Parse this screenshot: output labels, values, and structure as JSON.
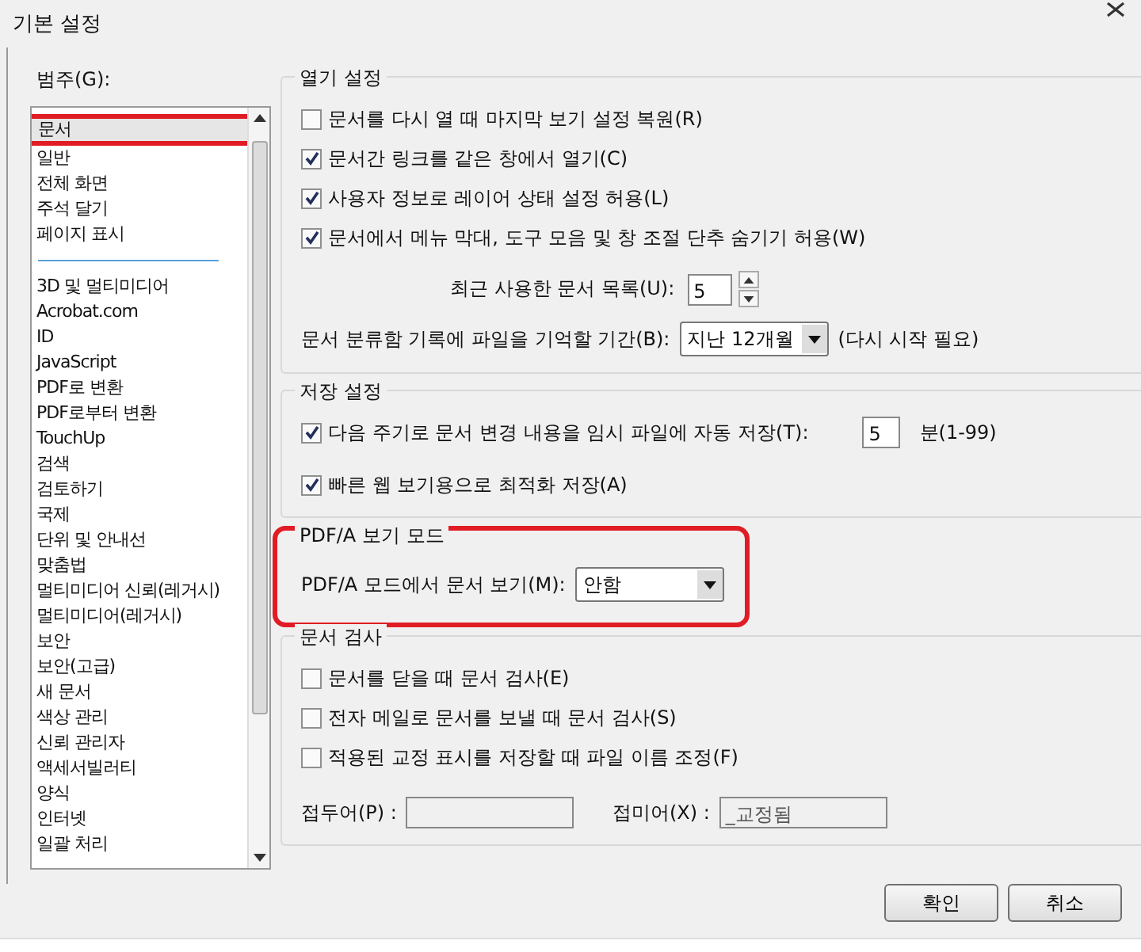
{
  "window": {
    "title": "기본 설정"
  },
  "category_label": "범주(G):",
  "categories": [
    {
      "kind": "item",
      "label": "문서",
      "selected": true,
      "highlighted": true
    },
    {
      "kind": "item",
      "label": "일반",
      "selected": false,
      "highlighted": false
    },
    {
      "kind": "item",
      "label": "전체 화면",
      "selected": false,
      "highlighted": false
    },
    {
      "kind": "item",
      "label": "주석 달기",
      "selected": false,
      "highlighted": false
    },
    {
      "kind": "item",
      "label": "페이지 표시",
      "selected": false,
      "highlighted": false
    },
    {
      "kind": "separator"
    },
    {
      "kind": "item",
      "label": "3D 및 멀티미디어",
      "selected": false,
      "highlighted": false
    },
    {
      "kind": "item",
      "label": "Acrobat.com",
      "selected": false,
      "highlighted": false
    },
    {
      "kind": "item",
      "label": "ID",
      "selected": false,
      "highlighted": false
    },
    {
      "kind": "item",
      "label": "JavaScript",
      "selected": false,
      "highlighted": false
    },
    {
      "kind": "item",
      "label": "PDF로 변환",
      "selected": false,
      "highlighted": false
    },
    {
      "kind": "item",
      "label": "PDF로부터 변환",
      "selected": false,
      "highlighted": false
    },
    {
      "kind": "item",
      "label": "TouchUp",
      "selected": false,
      "highlighted": false
    },
    {
      "kind": "item",
      "label": "검색",
      "selected": false,
      "highlighted": false
    },
    {
      "kind": "item",
      "label": "검토하기",
      "selected": false,
      "highlighted": false
    },
    {
      "kind": "item",
      "label": "국제",
      "selected": false,
      "highlighted": false
    },
    {
      "kind": "item",
      "label": "단위 및 안내선",
      "selected": false,
      "highlighted": false
    },
    {
      "kind": "item",
      "label": "맞춤법",
      "selected": false,
      "highlighted": false
    },
    {
      "kind": "item",
      "label": "멀티미디어 신뢰(레거시)",
      "selected": false,
      "highlighted": false
    },
    {
      "kind": "item",
      "label": "멀티미디어(레거시)",
      "selected": false,
      "highlighted": false
    },
    {
      "kind": "item",
      "label": "보안",
      "selected": false,
      "highlighted": false
    },
    {
      "kind": "item",
      "label": "보안(고급)",
      "selected": false,
      "highlighted": false
    },
    {
      "kind": "item",
      "label": "새 문서",
      "selected": false,
      "highlighted": false
    },
    {
      "kind": "item",
      "label": "색상 관리",
      "selected": false,
      "highlighted": false
    },
    {
      "kind": "item",
      "label": "신뢰 관리자",
      "selected": false,
      "highlighted": false
    },
    {
      "kind": "item",
      "label": "액세서빌러티",
      "selected": false,
      "highlighted": false
    },
    {
      "kind": "item",
      "label": "양식",
      "selected": false,
      "highlighted": false
    },
    {
      "kind": "item",
      "label": "인터넷",
      "selected": false,
      "highlighted": false
    },
    {
      "kind": "item",
      "label": "일괄 처리",
      "selected": false,
      "highlighted": false
    }
  ],
  "sections": [
    {
      "title": "열기 설정",
      "highlighted": false,
      "rows": [
        {
          "kind": "checkbox",
          "label": "문서를 다시 열 때 마지막 보기 설정 복원(R)",
          "checked": false
        },
        {
          "kind": "checkbox",
          "label": "문서간 링크를 같은 창에서 열기(C)",
          "checked": true
        },
        {
          "kind": "checkbox",
          "label": "사용자 정보로 레이어 상태 설정 허용(L)",
          "checked": true
        },
        {
          "kind": "checkbox",
          "label": "문서에서 메뉴 막대, 도구 모음 및 창 조절 단추 숨기기 허용(W)",
          "checked": true
        },
        {
          "kind": "spinner",
          "label": "최근 사용한 문서 목록(U):",
          "value": "5"
        },
        {
          "kind": "dropdown",
          "label": "문서 분류함 기록에 파일을 기억할 기간(B):",
          "value": "지난 12개월",
          "note": "(다시 시작 필요)"
        }
      ]
    },
    {
      "title": "저장 설정",
      "highlighted": false,
      "rows": [
        {
          "kind": "checkbox_field",
          "label": "다음 주기로 문서 변경 내용을 임시 파일에 자동 저장(T):",
          "checked": true,
          "value": "5",
          "unit": "분(1-99)"
        },
        {
          "kind": "checkbox",
          "label": "빠른 웹 보기용으로 최적화 저장(A)",
          "checked": true
        }
      ]
    },
    {
      "title": "PDF/A 보기 모드",
      "highlighted": true,
      "rows": [
        {
          "kind": "dropdown",
          "label": "PDF/A 모드에서 문서 보기(M):",
          "value": "안함"
        }
      ]
    },
    {
      "title": "문서 검사",
      "highlighted": false,
      "rows": [
        {
          "kind": "checkbox",
          "label": "문서를 닫을 때 문서 검사(E)",
          "checked": false
        },
        {
          "kind": "checkbox",
          "label": "전자 메일로 문서를 보낼 때 문서 검사(S)",
          "checked": false
        },
        {
          "kind": "checkbox",
          "label": "적용된 교정 표시를 저장할 때 파일 이름 조정(F)",
          "checked": false
        },
        {
          "kind": "text_fields",
          "fields": [
            {
              "label": "접두어(P) :",
              "disabled": true
            },
            {
              "label": "접미어(X) :",
              "value": "_교정됨",
              "disabled": true
            }
          ]
        }
      ]
    }
  ],
  "buttons": [
    "확인",
    "취소"
  ]
}
